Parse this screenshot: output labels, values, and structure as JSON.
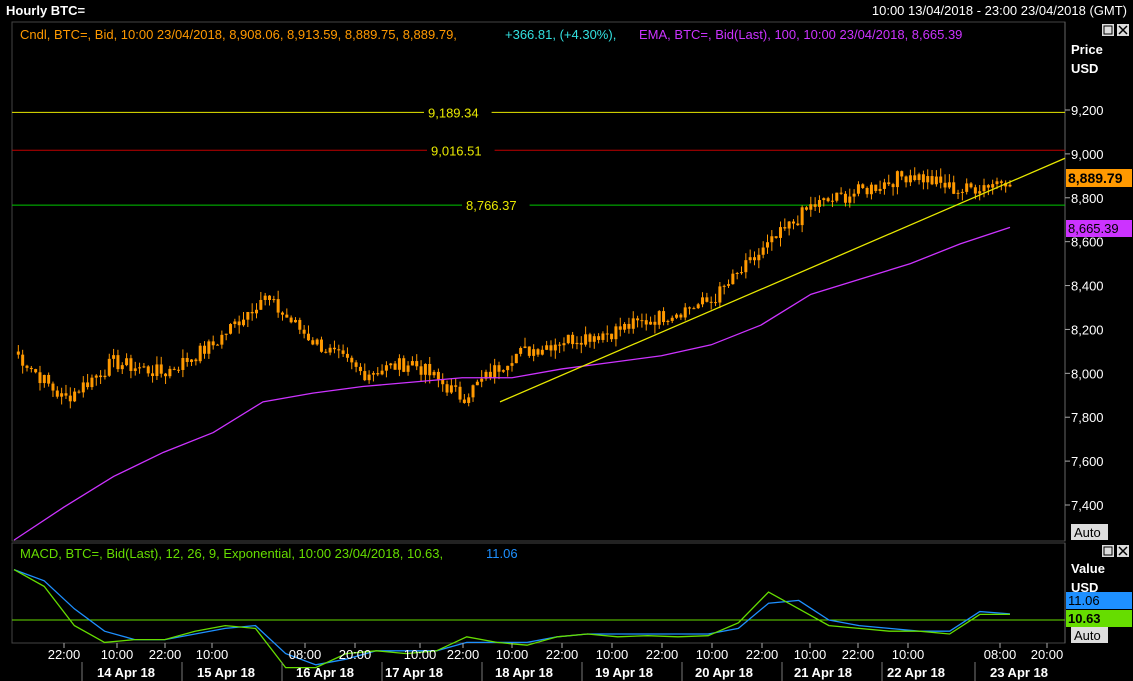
{
  "window": {
    "title": "Hourly BTC=",
    "range": "10:00 13/04/2018 - 23:00 23/04/2018 (GMT)"
  },
  "price_panel": {
    "legend_candle": "Cndl, BTC=, Bid, 10:00 23/04/2018, 8,908.06, 8,913.59, 8,889.75, 8,889.79,",
    "legend_change": "+366.81, (+4.30%),",
    "legend_ema": "EMA, BTC=, Bid(Last),  100, 10:00 23/04/2018, 8,665.39",
    "axis_title_1": "Price",
    "axis_title_2": "USD",
    "last_price": "8,889.79",
    "ema_value": "8,665.39",
    "auto_label": "Auto",
    "hlines": [
      {
        "label": "9,189.34",
        "value": 9189.34,
        "color": "#e8e800"
      },
      {
        "label": "9,016.51",
        "value": 9016.51,
        "color": "#c00000"
      },
      {
        "label": "8,766.37",
        "value": 8766.37,
        "color": "#00c800"
      }
    ],
    "y_ticks": [
      "7,400",
      "7,600",
      "7,800",
      "8,000",
      "8,200",
      "8,400",
      "8,600",
      "8,800",
      "9,000",
      "9,200"
    ]
  },
  "macd_panel": {
    "legend_main": "MACD, BTC=, Bid(Last),  12, 26, 9, Exponential, 10:00 23/04/2018, 10.63,",
    "legend_signal": "11.06",
    "axis_title_1": "Value",
    "axis_title_2": "USD",
    "signal_value": "11.06",
    "macd_value": "10.63",
    "auto_label": "Auto"
  },
  "x_axis": {
    "time_ticks": [
      "22:00",
      "10:00",
      "22:00",
      "10:00",
      "08:00",
      "20:00",
      "10:00",
      "22:00",
      "10:00",
      "22:00",
      "10:00",
      "22:00",
      "10:00",
      "22:00",
      "10:00",
      "22:00",
      "10:00",
      "08:00",
      "20:00"
    ],
    "date_ticks": [
      "14 Apr 18",
      "15 Apr 18",
      "16 Apr 18",
      "17 Apr 18",
      "18 Apr 18",
      "19 Apr 18",
      "20 Apr 18",
      "21 Apr 18",
      "22 Apr 18",
      "23 Apr 18"
    ]
  },
  "chart_data": {
    "type": "line",
    "x_range": [
      "10:00 13/04/2018",
      "23:00 23/04/2018"
    ],
    "ylim": [
      7250,
      9300
    ],
    "colors": {
      "candle": "#ff9900",
      "ema": "#cc33ff",
      "trend": "#e8e800",
      "macd": "#66dd00",
      "signal": "#1e90ff"
    },
    "series": [
      {
        "name": "Cndl, BTC=, Bid",
        "x": [
          "13 Apr 10:00",
          "14 Apr 00:00",
          "14 Apr 10:00",
          "14 Apr 22:00",
          "15 Apr 10:00",
          "15 Apr 22:00",
          "16 Apr 08:00",
          "16 Apr 20:00",
          "17 Apr 10:00",
          "17 Apr 22:00",
          "18 Apr 10:00",
          "18 Apr 22:00",
          "19 Apr 10:00",
          "19 Apr 22:00",
          "20 Apr 10:00",
          "20 Apr 22:00",
          "21 Apr 10:00",
          "21 Apr 22:00",
          "22 Apr 10:00",
          "22 Apr 22:00",
          "23 Apr 10:00"
        ],
        "values": [
          8100,
          7880,
          8050,
          8000,
          8130,
          8350,
          8150,
          8000,
          8050,
          7890,
          8080,
          8150,
          8190,
          8260,
          8330,
          8550,
          8760,
          8830,
          8910,
          8830,
          8890
        ]
      },
      {
        "name": "EMA, BTC=, Bid(Last), 100",
        "x": [
          "13 Apr 10:00",
          "14 Apr 00:00",
          "14 Apr 10:00",
          "14 Apr 22:00",
          "15 Apr 10:00",
          "15 Apr 22:00",
          "16 Apr 08:00",
          "16 Apr 20:00",
          "17 Apr 10:00",
          "17 Apr 22:00",
          "18 Apr 10:00",
          "18 Apr 22:00",
          "19 Apr 10:00",
          "19 Apr 22:00",
          "20 Apr 10:00",
          "20 Apr 22:00",
          "21 Apr 10:00",
          "21 Apr 22:00",
          "22 Apr 10:00",
          "22 Apr 22:00",
          "23 Apr 10:00"
        ],
        "values": [
          7240,
          7390,
          7530,
          7640,
          7730,
          7870,
          7910,
          7940,
          7960,
          7980,
          7980,
          8020,
          8050,
          8080,
          8130,
          8220,
          8360,
          8430,
          8500,
          8590,
          8665
        ]
      }
    ],
    "macd": {
      "name": "MACD, BTC=, Bid(Last), 12, 26, 9, Exponential",
      "ylim": [
        -140,
        100
      ],
      "values": [
        90,
        60,
        -10,
        -40,
        -35,
        -35,
        -20,
        -10,
        -15,
        -85,
        -85,
        -60,
        -55,
        -60,
        -55,
        -30,
        -40,
        -45,
        -30,
        -25,
        -30,
        -28,
        -30,
        -28,
        -5,
        50,
        20,
        -10,
        -15,
        -20,
        -20,
        -25,
        10,
        10
      ],
      "signal": [
        90,
        70,
        20,
        -20,
        -35,
        -35,
        -25,
        -15,
        -10,
        -60,
        -80,
        -70,
        -55,
        -55,
        -55,
        -40,
        -40,
        -40,
        -30,
        -25,
        -25,
        -25,
        -25,
        -25,
        -15,
        30,
        35,
        0,
        -10,
        -15,
        -20,
        -20,
        15,
        11
      ]
    }
  }
}
